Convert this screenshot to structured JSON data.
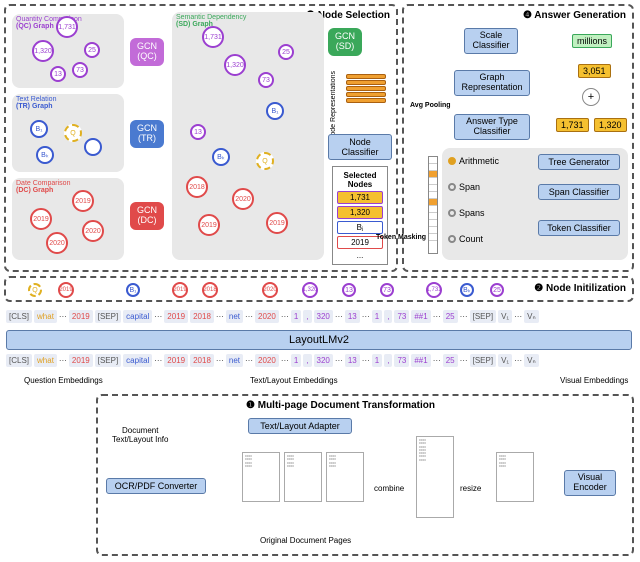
{
  "sections": {
    "s3": "❸ Node Selection",
    "s4": "❹ Answer Generation",
    "s2": "❷ Node Initilization",
    "s1": "❶ Multi-page Document Transformation"
  },
  "graphs": {
    "qc_label": "Quantity Comparison",
    "qc_abbr": "(QC) Graph",
    "sd_label": "Semantic Dependency",
    "sd_abbr": "(SD) Graph",
    "tr_label": "Text Relation",
    "tr_abbr": "(TR) Graph",
    "dc_label": "Date Comparison",
    "dc_abbr": "(DC) Graph"
  },
  "gcn": {
    "qc": "GCN\n(QC)",
    "tr": "GCN\n(TR)",
    "dc": "GCN\n(DC)",
    "sd": "GCN\n(SD)"
  },
  "nodes": {
    "v1731": "1,731",
    "v1320": "1,320",
    "v25": "25",
    "v73": "73",
    "v13": "13",
    "q": "Q",
    "b1": "B₁",
    "bk": "Bₖ",
    "y2019": "2019",
    "y2020": "2020",
    "y2018": "2018"
  },
  "mods": {
    "node_repr": "Node\nRepresentations",
    "node_cls": "Node Classifier",
    "selected": "Selected Nodes",
    "avg_pool": "Avg Pooling",
    "graph_repr": "Graph\nRepresentation",
    "scale_cls": "Scale\nClassifier",
    "ans_type": "Answer Type\nClassifier",
    "tree_gen": "Tree Generator",
    "span_cls": "Span Classifier",
    "token_cls": "Token Classifier",
    "token_mask": "Token Masking",
    "layoutlm": "LayoutLMv2",
    "ocr": "OCR/PDF Converter",
    "adapter": "Text/Layout Adapter",
    "visual_enc": "Visual\nEncoder",
    "doc_info": "Document\nText/Layout Info",
    "orig_pages": "Original Document Pages",
    "combine": "combine",
    "resize": "resize"
  },
  "ans_types": {
    "arith": "Arithmetic",
    "span": "Span",
    "spans": "Spans",
    "count": "Count"
  },
  "results": {
    "millions": "millions",
    "sum": "3,051",
    "v1": "1,731",
    "v2": "1,320"
  },
  "selected_items": {
    "a": "1,731",
    "b": "1,320",
    "c": "Bⱼ",
    "d": "2019",
    "e": "..."
  },
  "emb_labels": {
    "q": "Question Embeddings",
    "t": "Text/Layout Embeddings",
    "v": "Visual Embeddings"
  },
  "tokens": {
    "cls": "[CLS]",
    "sep": "[SEP]",
    "what": "what",
    "y2019": "2019",
    "capital": "capital",
    "y2018": "2018",
    "net": "net",
    "y2020": "2020",
    "one": "1",
    "comma": ",",
    "n320": "320",
    "n13": "13",
    "n73": "73",
    "hh1": "##1",
    "n25": "25",
    "v1": "V₁",
    "vn": "Vₙ"
  },
  "dots": "⋯"
}
